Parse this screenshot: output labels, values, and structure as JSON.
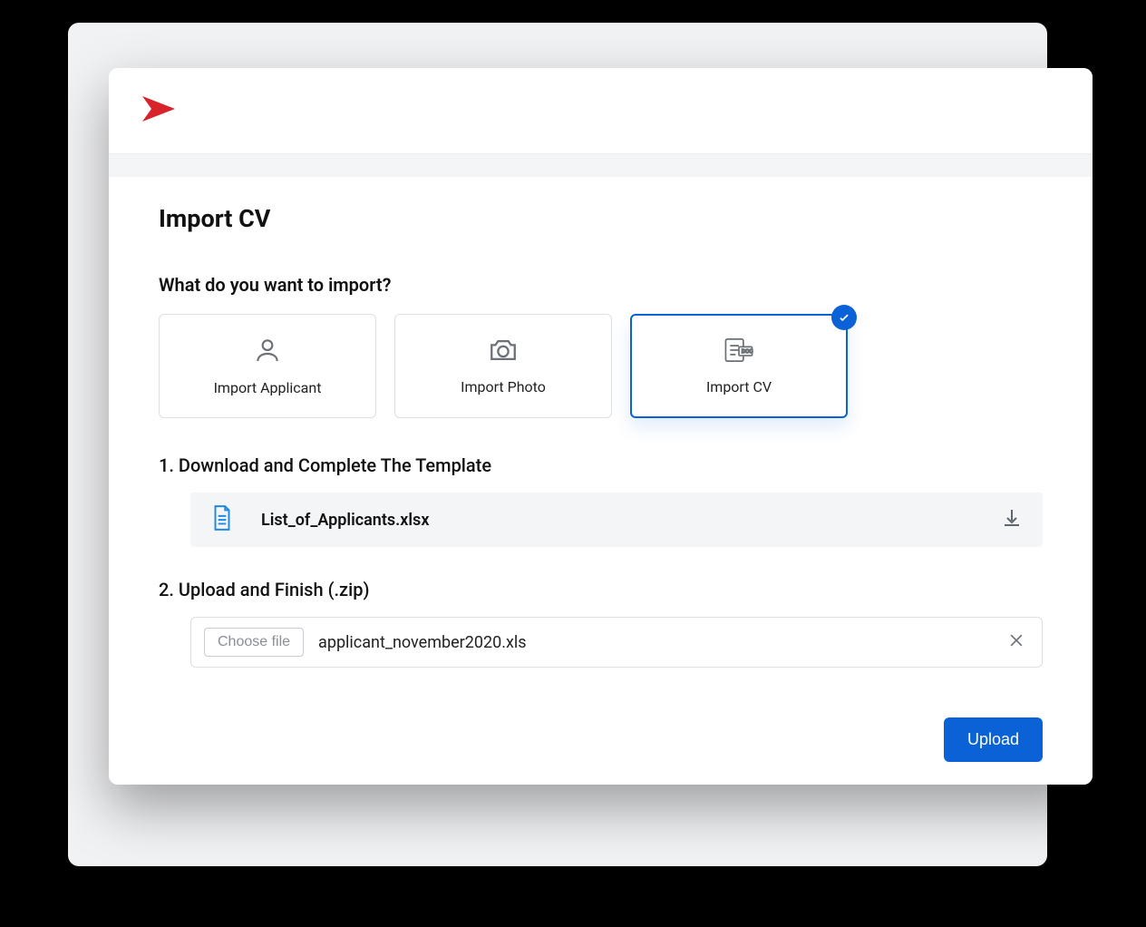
{
  "page_title": "Import CV",
  "question": "What do you want to import?",
  "options": [
    {
      "label": "Import Applicant",
      "icon": "person-icon",
      "selected": false
    },
    {
      "label": "Import Photo",
      "icon": "camera-icon",
      "selected": false
    },
    {
      "label": "Import CV",
      "icon": "document-icon",
      "selected": true
    }
  ],
  "step1": {
    "heading": "1. Download and Complete The Template",
    "file_name": "List_of_Applicants.xlsx"
  },
  "step2": {
    "heading": "2. Upload and Finish (.zip)",
    "choose_label": "Choose file",
    "chosen_file": "applicant_november2020.xls"
  },
  "upload_button": "Upload",
  "colors": {
    "primary": "#0b62d6",
    "logo": "#d8232a"
  }
}
